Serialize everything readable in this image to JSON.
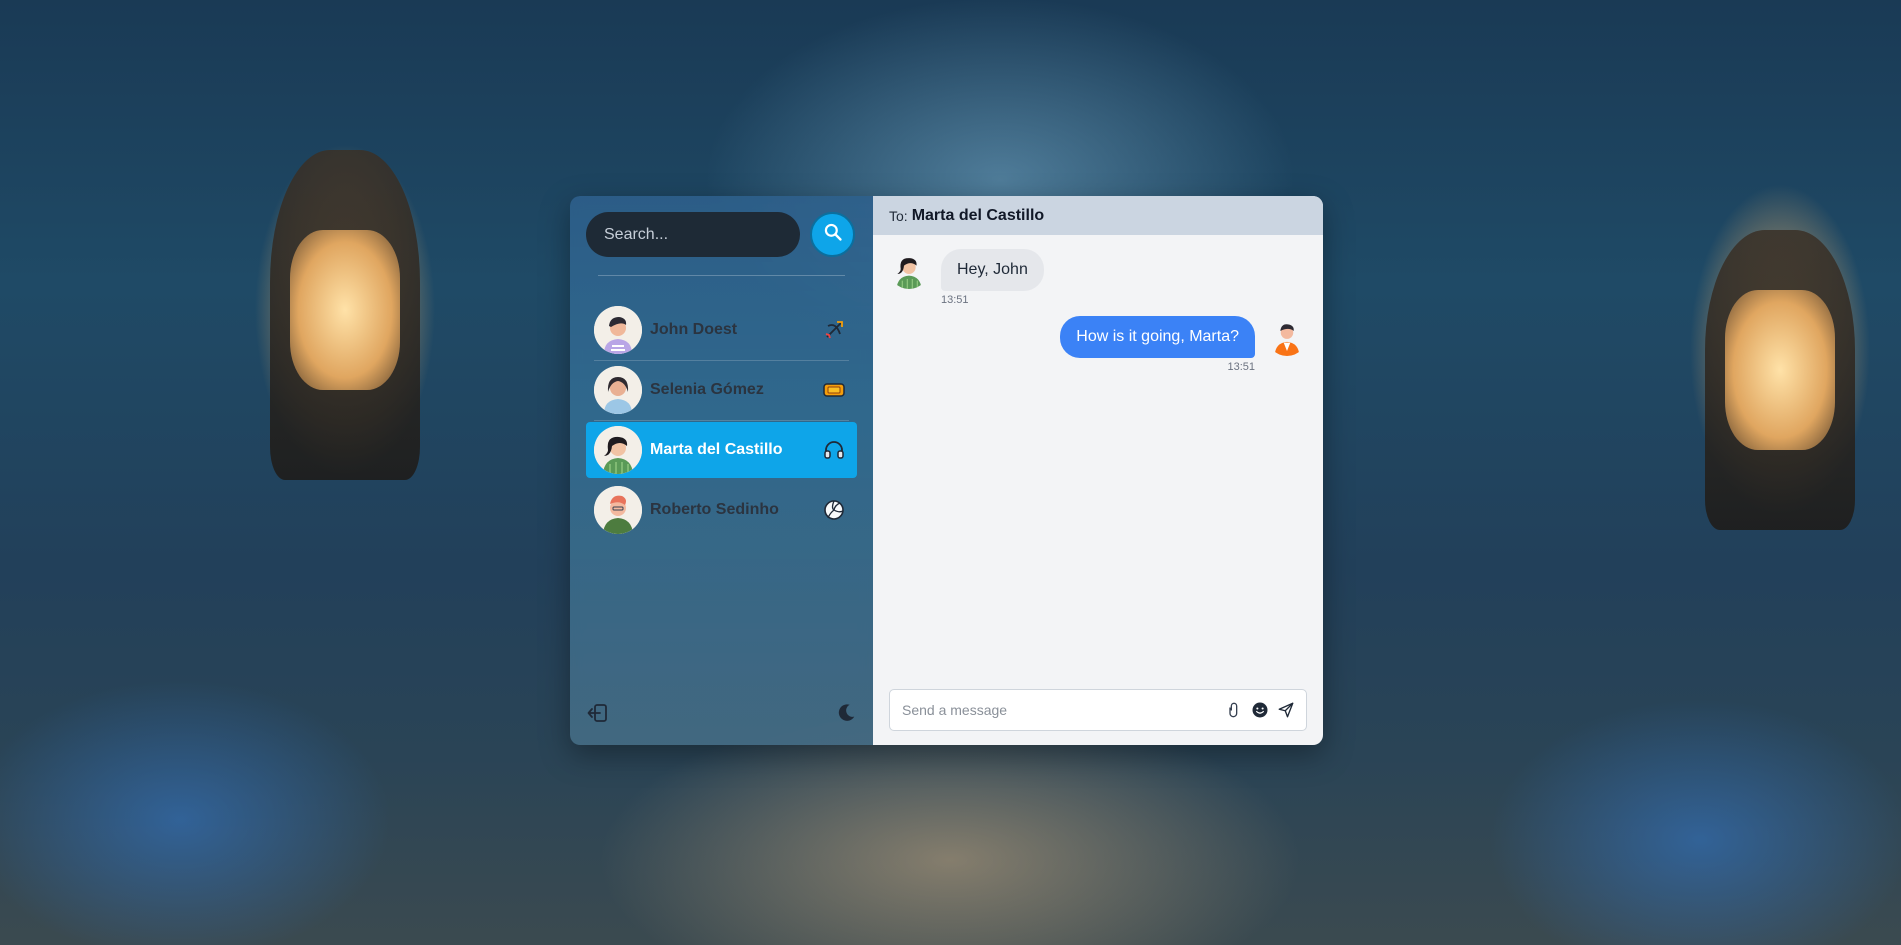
{
  "sidebar": {
    "search": {
      "placeholder": "Search..."
    },
    "contacts": [
      {
        "name": "John Doest",
        "badge_icon": "bow-arrow-icon",
        "active": false
      },
      {
        "name": "Selenia Gómez",
        "badge_icon": "ticket-icon",
        "active": false
      },
      {
        "name": "Marta del Castillo",
        "badge_icon": "headphones-icon",
        "active": true
      },
      {
        "name": "Roberto Sedinho",
        "badge_icon": "volleyball-icon",
        "active": false
      }
    ]
  },
  "chat": {
    "to_label": "To:",
    "recipient": "Marta del Castillo",
    "messages": [
      {
        "direction": "incoming",
        "text": "Hey, John",
        "time": "13:51"
      },
      {
        "direction": "outgoing",
        "text": "How is it going, Marta?",
        "time": "13:51"
      }
    ],
    "composer": {
      "placeholder": "Send a message"
    }
  },
  "colors": {
    "accent": "#0ea5e9",
    "outgoing_bubble": "#3b82f6",
    "incoming_bubble": "#e5e7eb",
    "header_bg": "#cbd5e1"
  }
}
